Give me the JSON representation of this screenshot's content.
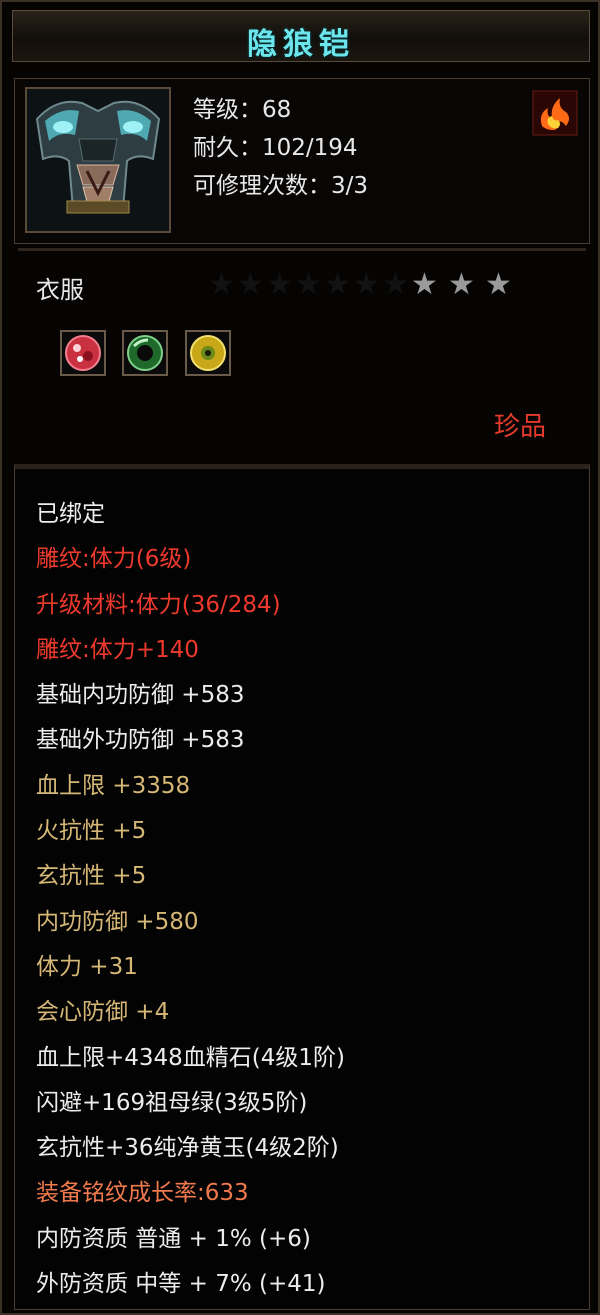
{
  "item": {
    "name": "隐狼铠",
    "stats_header": [
      "等级：68",
      "耐久：102/194",
      "可修理次数：3/3"
    ],
    "type": "衣服",
    "rarity": "珍品",
    "stars": {
      "total": 10,
      "lit": 3
    },
    "gems": [
      {
        "icon": "red-gem-icon",
        "color": "#c0303a"
      },
      {
        "icon": "green-jade-icon",
        "color": "#2f8a3a"
      },
      {
        "icon": "yellow-jade-icon",
        "color": "#c8a818"
      }
    ]
  },
  "colors": {
    "title": "#6ce6ec",
    "white": "#ececec",
    "red": "#ee3a2c",
    "gold": "#d5b776",
    "orange": "#f07a4e"
  },
  "lines": [
    {
      "text": "已绑定",
      "style": "white"
    },
    {
      "text": "雕纹:体力(6级)",
      "style": "red"
    },
    {
      "text": "升级材料:体力(36/284)",
      "style": "red"
    },
    {
      "text": "雕纹:体力+140",
      "style": "red"
    },
    {
      "text": "基础内功防御  +583",
      "style": "white"
    },
    {
      "text": "基础外功防御  +583",
      "style": "white"
    },
    {
      "text": "血上限  +3358",
      "style": "gold"
    },
    {
      "text": "火抗性  +5",
      "style": "gold"
    },
    {
      "text": "玄抗性  +5",
      "style": "gold"
    },
    {
      "text": "内功防御  +580",
      "style": "gold"
    },
    {
      "text": "体力  +31",
      "style": "gold"
    },
    {
      "text": "会心防御  +4",
      "style": "gold"
    },
    {
      "text": "血上限+4348血精石(4级1阶)",
      "style": "white"
    },
    {
      "text": "闪避+169祖母绿(3级5阶)",
      "style": "white"
    },
    {
      "text": "玄抗性+36纯净黄玉(4级2阶)",
      "style": "white"
    },
    {
      "text": "装备铭纹成长率:633",
      "style": "orange"
    },
    {
      "text": "内防资质  普通  + 1% (+6)",
      "style": "white"
    },
    {
      "text": "外防资质  中等  + 7% (+41)",
      "style": "white"
    }
  ]
}
